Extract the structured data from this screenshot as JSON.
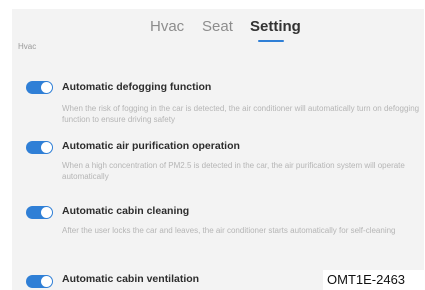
{
  "tabs": [
    {
      "label": "Hvac",
      "active": false
    },
    {
      "label": "Seat",
      "active": false
    },
    {
      "label": "Setting",
      "active": true
    }
  ],
  "accent_color": "#2f7fd6",
  "section_label": "Hvac",
  "items": [
    {
      "title": "Automatic defogging function",
      "description": "When the risk of fogging in the car is detected, the air conditioner will automatically turn on defogging function to ensure driving safety",
      "enabled": true
    },
    {
      "title": "Automatic air purification operation",
      "description": "When a high concentration of PM2.5 is detected in the car, the air purification system will operate automatically",
      "enabled": true
    },
    {
      "title": "Automatic cabin cleaning",
      "description": "After the user locks the car and leaves, the air conditioner starts automatically for self-cleaning",
      "enabled": true
    },
    {
      "title": "Automatic cabin ventilation",
      "description": "",
      "enabled": true
    }
  ],
  "caption": "OMT1E-2463"
}
